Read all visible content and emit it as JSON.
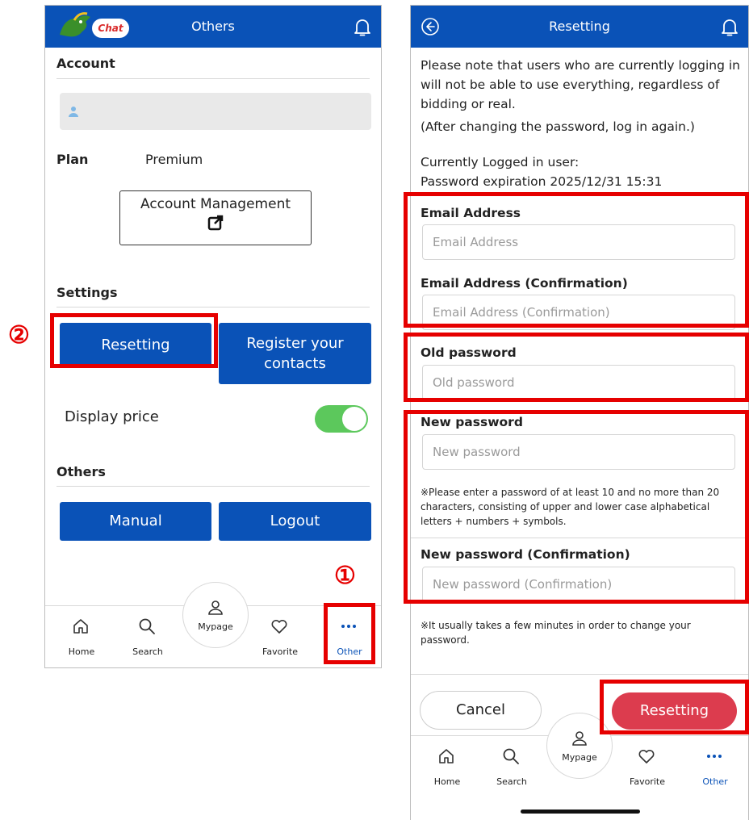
{
  "screen1": {
    "header": {
      "logo_text": "Chat",
      "title": "Others",
      "bell_icon": "bell-icon"
    },
    "account": {
      "section_title": "Account",
      "plan_label": "Plan",
      "plan_value": "Premium",
      "account_mgmt_label": "Account Management"
    },
    "settings": {
      "section_title": "Settings",
      "resetting_label": "Resetting",
      "register_contacts_label": "Register your contacts",
      "display_price_label": "Display price",
      "display_price_on": true
    },
    "others": {
      "section_title": "Others",
      "manual_label": "Manual",
      "logout_label": "Logout"
    },
    "nav": [
      {
        "label": "Home",
        "icon": "home-icon"
      },
      {
        "label": "Search",
        "icon": "search-icon"
      },
      {
        "label": "Mypage",
        "icon": "user-icon"
      },
      {
        "label": "Favorite",
        "icon": "heart-icon"
      },
      {
        "label": "Other",
        "icon": "more-icon",
        "active": true
      }
    ]
  },
  "screen2": {
    "header": {
      "title": "Resetting"
    },
    "intro": "Please note that users who are currently logging in will not be able to use everything, regardless of bidding or real.",
    "intro2": "(After changing the password, log in again.)",
    "current_user": "Currently Logged in user:",
    "expiration": "Password expiration 2025/12/31 15:31",
    "fields": {
      "email_label": "Email Address",
      "email_placeholder": "Email Address",
      "email_confirm_label": "Email Address (Confirmation)",
      "email_confirm_placeholder": "Email Address (Confirmation)",
      "old_pw_label": "Old password",
      "old_pw_placeholder": "Old password",
      "new_pw_label": "New password",
      "new_pw_placeholder": "New password",
      "pw_rule_note": "※Please enter a password of at least 10 and no more than 20 characters, consisting of upper and lower case alphabetical letters + numbers + symbols.",
      "new_pw_confirm_label": "New password (Confirmation)",
      "new_pw_confirm_placeholder": "New password (Confirmation)"
    },
    "change_note": "※It usually takes a few minutes in order to change your password.",
    "cancel_label": "Cancel",
    "submit_label": "Resetting",
    "nav": [
      {
        "label": "Home"
      },
      {
        "label": "Search"
      },
      {
        "label": "Mypage"
      },
      {
        "label": "Favorite"
      },
      {
        "label": "Other"
      }
    ]
  },
  "annotations": {
    "step1": "①",
    "step2": "②"
  },
  "colors": {
    "primary": "#0a52b7",
    "accent_red": "#e60000",
    "submit_red": "#dc3c4e",
    "toggle_green": "#5cc85c"
  }
}
